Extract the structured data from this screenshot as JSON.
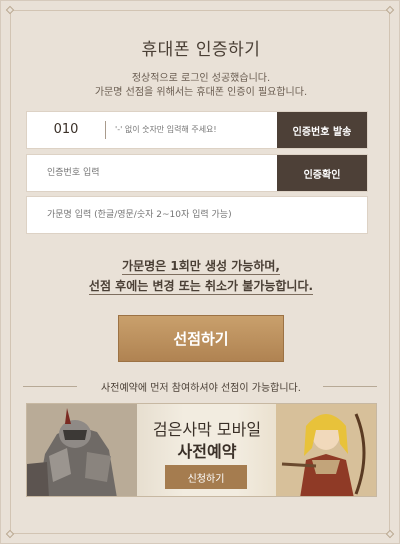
{
  "page": {
    "title": "휴대폰 인증하기",
    "description_line1": "정상적으로 로그인 성공했습니다.",
    "description_line2": "가문명 선점을 위해서는 휴대폰 인증이 필요합니다."
  },
  "phone": {
    "prefix": "010",
    "placeholder": "'-' 없이 숫자만 입력해 주세요!",
    "send_button": "인증번호 발송"
  },
  "verify": {
    "placeholder": "인증번호 입력",
    "confirm_button": "인증확인"
  },
  "family_name": {
    "placeholder": "가문명 입력 (한글/영문/숫자 2~10자 입력 가능)"
  },
  "notice": {
    "line1": "가문명은 1회만 생성 가능하며,",
    "line2": "선점 후에는 변경 또는 취소가 불가능합니다."
  },
  "reserve_button": "선점하기",
  "pre_register_notice": "사전예약에 먼저 참여하셔야 선점이 가능합니다.",
  "banner": {
    "title": "검은사막 모바일",
    "subtitle": "사전예약",
    "button": "신청하기"
  }
}
